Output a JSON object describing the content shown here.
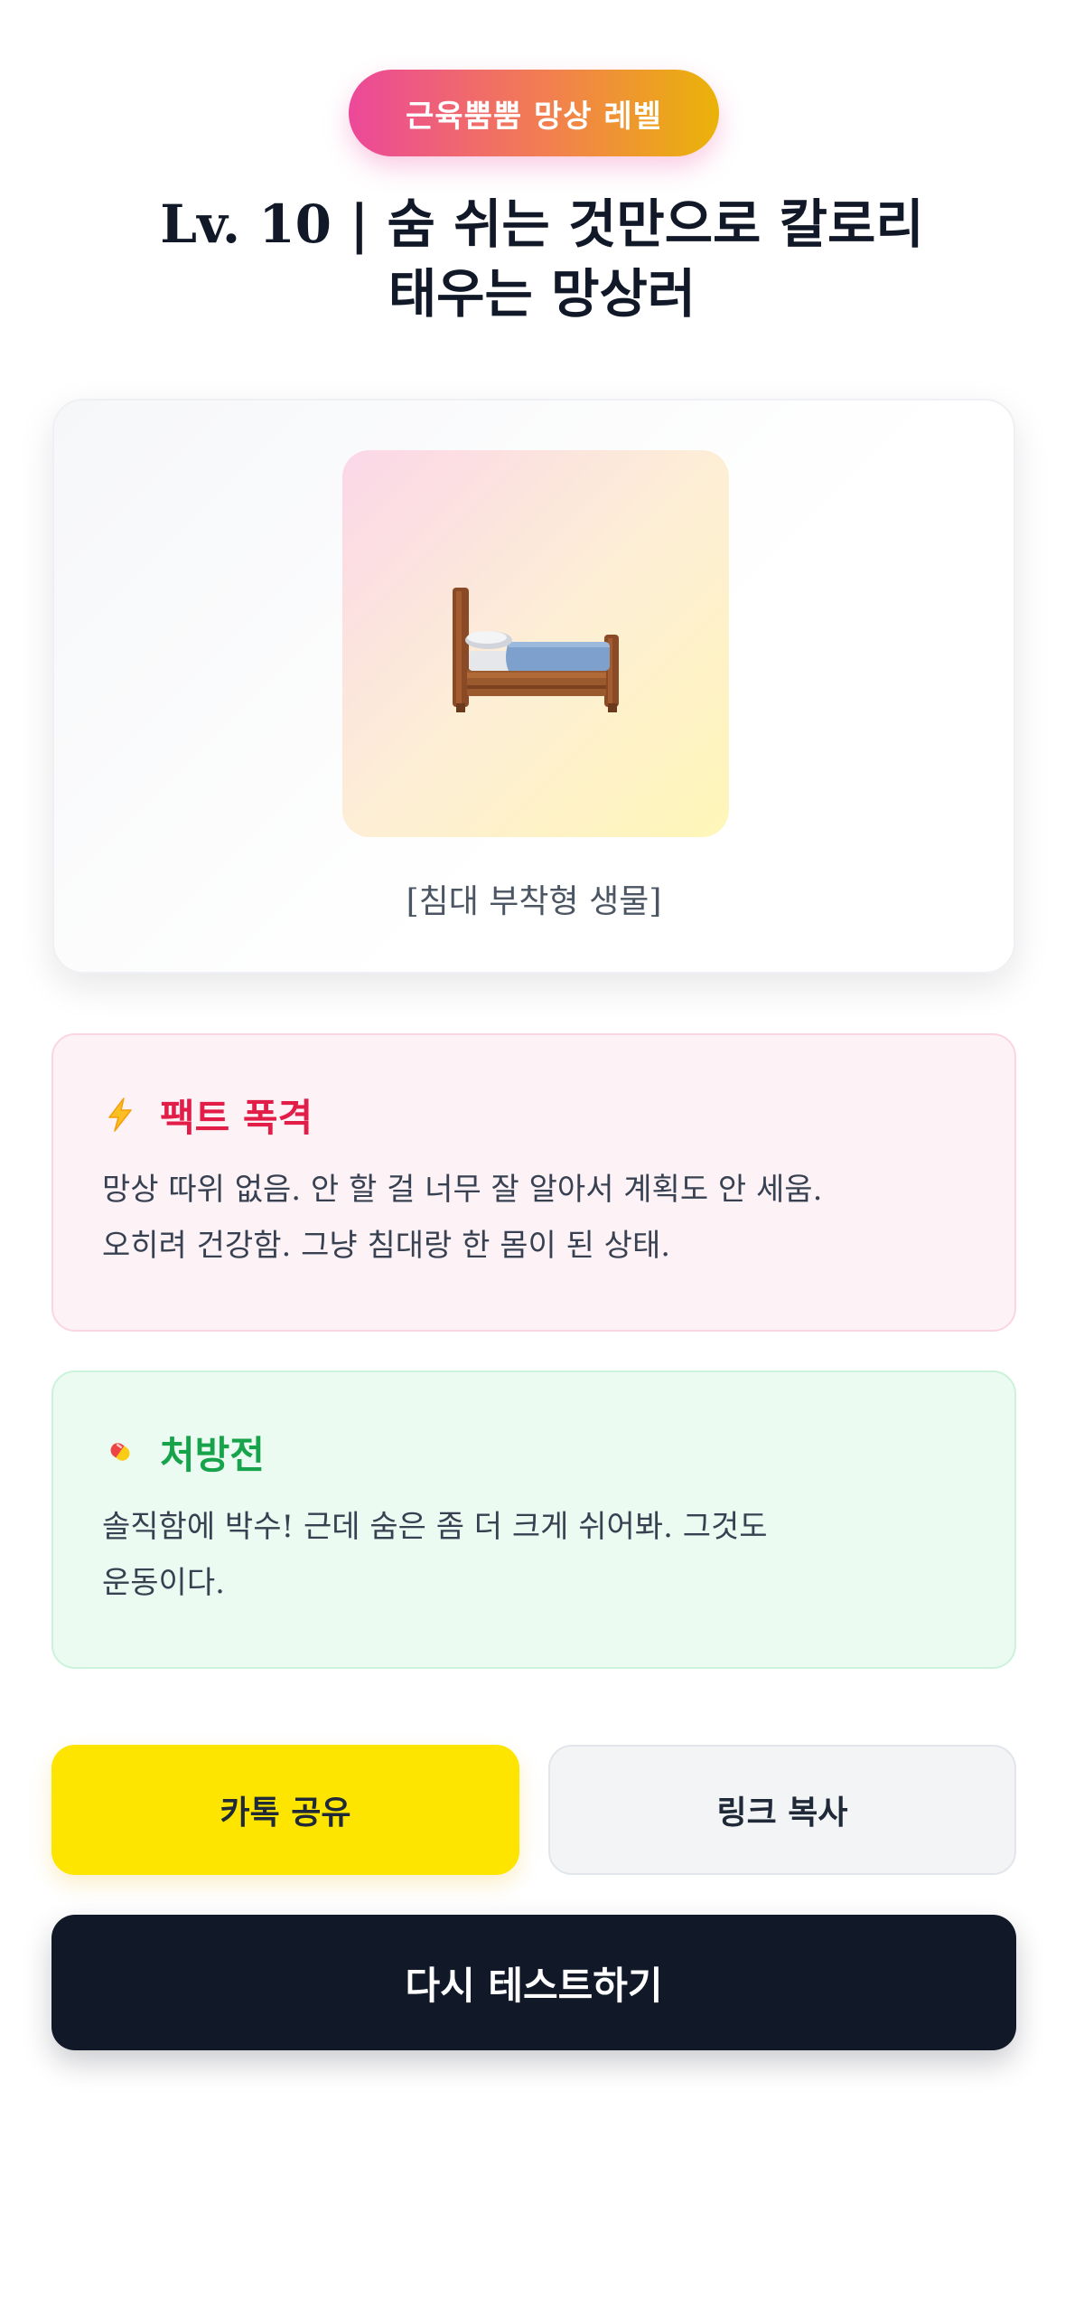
{
  "header": {
    "badge_label": "근육뿜뿜 망상 레벨",
    "title_line1": "Lv. 10 | 숨 쉬는 것만으로 칼로리",
    "title_line2": "태우는 망상러"
  },
  "result": {
    "image_icon": "bed-icon",
    "caption": "[침대 부착형 생물]"
  },
  "fact_card": {
    "icon": "lightning-icon",
    "title": "팩트 폭격",
    "line1": "망상 따위 없음. 안 할 걸 너무 잘 알아서 계획도 안 세움.",
    "line2": "오히려 건강함. 그냥 침대랑 한 몸이 된 상태."
  },
  "prescription_card": {
    "icon": "pill-icon",
    "title": "처방전",
    "line1": "솔직함에 박수! 근데 숨은 좀 더 크게 쉬어봐. 그것도",
    "line2": "운동이다."
  },
  "actions": {
    "kakao_share_label": "카톡 공유",
    "copy_link_label": "링크 복사",
    "retry_label": "다시 테스트하기"
  },
  "colors": {
    "badge_gradient_start": "#ec4899",
    "badge_gradient_end": "#eab308",
    "fact_title": "#e11d48",
    "prescription_title": "#16a34a",
    "kakao_yellow": "#fee500",
    "retry_dark": "#111827"
  }
}
